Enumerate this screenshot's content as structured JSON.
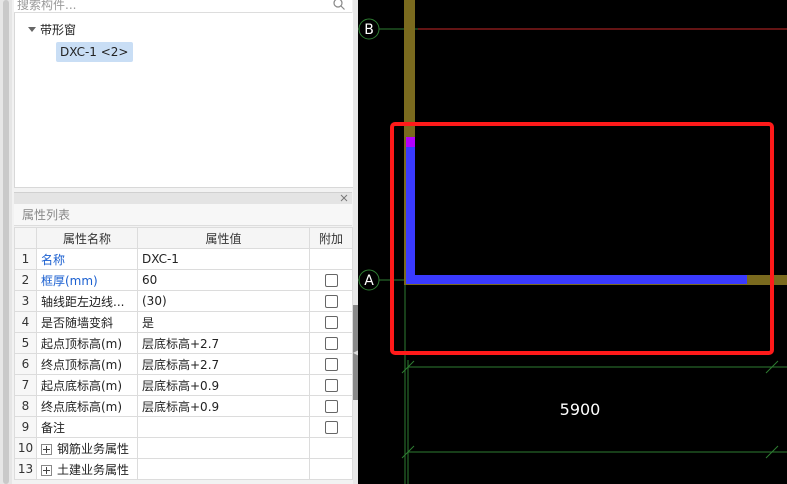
{
  "search": {
    "placeholder": "搜索构件..."
  },
  "tree": {
    "group_label": "带形窗",
    "item_label": "DXC-1 <2>"
  },
  "properties": {
    "title": "属性列表",
    "columns": {
      "name": "属性名称",
      "value": "属性值",
      "extra": "附加"
    },
    "rows": [
      {
        "num": "1",
        "name": "名称",
        "value": "DXC-1"
      },
      {
        "num": "2",
        "name": "框厚(mm)",
        "value": "60"
      },
      {
        "num": "3",
        "name": "轴线距左边线...",
        "value": "(30)"
      },
      {
        "num": "4",
        "name": "是否随墙变斜",
        "value": "是"
      },
      {
        "num": "5",
        "name": "起点顶标高(m)",
        "value": "层底标高+2.7"
      },
      {
        "num": "6",
        "name": "终点顶标高(m)",
        "value": "层底标高+2.7"
      },
      {
        "num": "7",
        "name": "起点底标高(m)",
        "value": "层底标高+0.9"
      },
      {
        "num": "8",
        "name": "终点底标高(m)",
        "value": "层底标高+0.9"
      },
      {
        "num": "9",
        "name": "备注",
        "value": ""
      },
      {
        "num": "10",
        "name": "钢筋业务属性",
        "value": ""
      },
      {
        "num": "13",
        "name": "土建业务属性",
        "value": ""
      }
    ]
  },
  "canvas": {
    "axis_b": "B",
    "axis_a": "A",
    "dimension": "5900",
    "colors": {
      "background": "#000000",
      "grid_green": "#2e7d32",
      "grid_red": "#c62828",
      "wall": "#7a6a1e",
      "window": "#3a3aff",
      "highlight": "#ff1a1a"
    }
  }
}
